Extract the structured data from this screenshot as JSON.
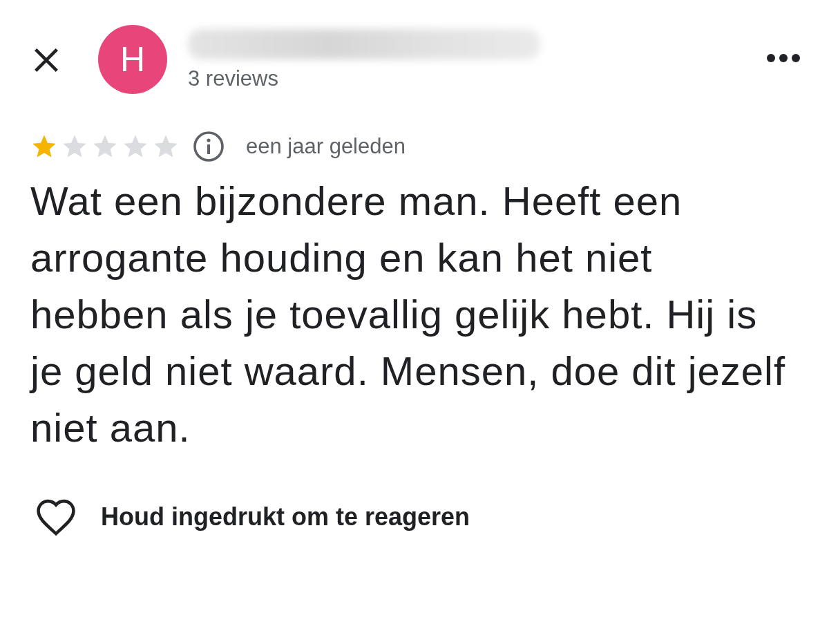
{
  "header": {
    "avatar_letter": "H",
    "review_count": "3 reviews"
  },
  "review": {
    "stars": 1,
    "time": "een jaar geleden",
    "text": "Wat een bijzondere man. Heeft een arrogante houding en kan het niet hebben als je toevallig gelijk hebt. Hij is je geld niet waard. Mensen, doe dit jezelf niet aan."
  },
  "reaction": {
    "label": "Houd ingedrukt om te reageren",
    "liked": false
  }
}
